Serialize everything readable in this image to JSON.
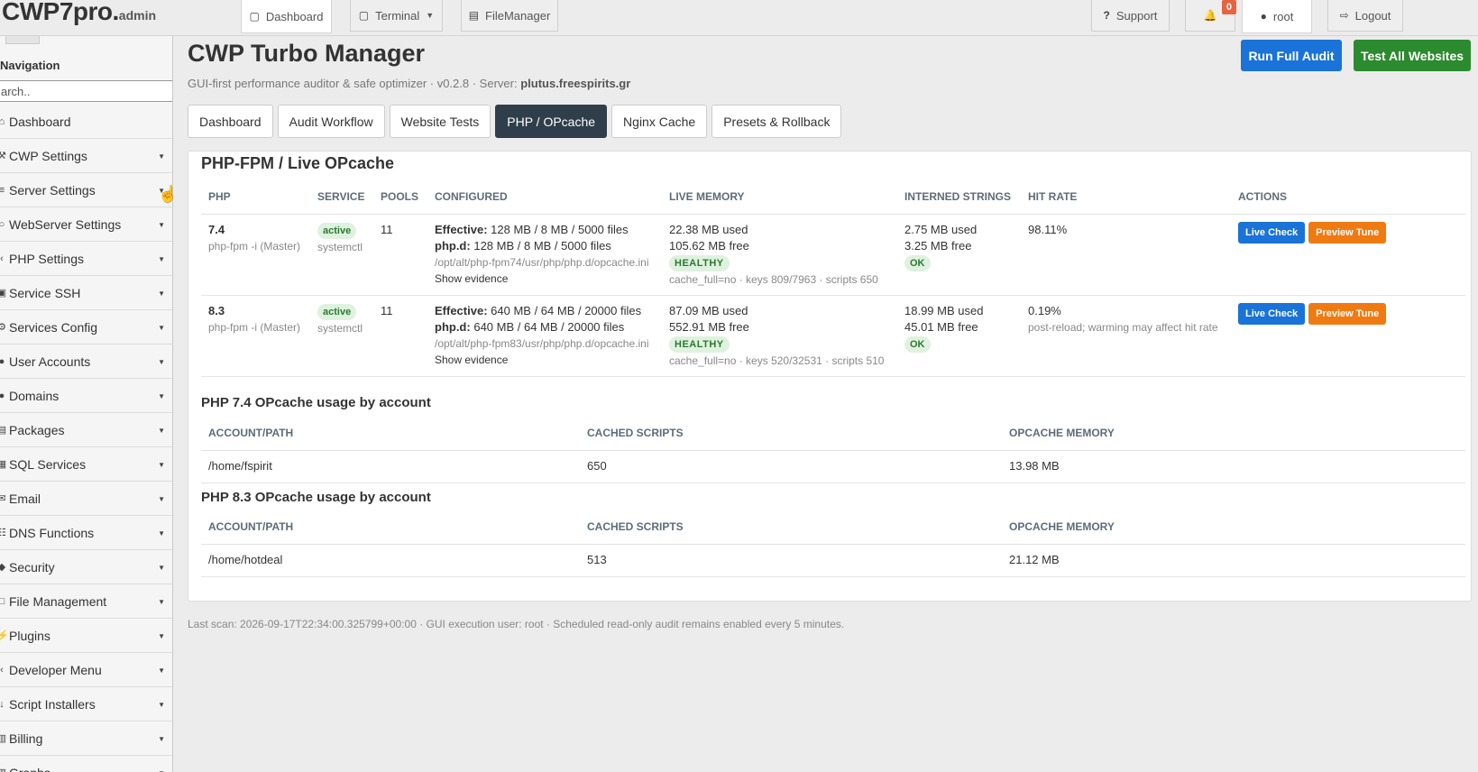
{
  "topbar": {
    "brand": "CWP7pro.",
    "brand_sub": "admin",
    "tabs": [
      {
        "label": "Dashboard",
        "icon": "monitor-icon"
      },
      {
        "label": "Terminal",
        "icon": "monitor-icon"
      },
      {
        "label": "FileManager",
        "icon": "folder-icon"
      }
    ],
    "support_label": "Support",
    "notifications_count": "0",
    "user_label": "root",
    "logout_label": "Logout"
  },
  "sidebar": {
    "title": "Navigation",
    "search_placeholder": "Search..",
    "search_value": "arch..",
    "items": [
      {
        "label": "Dashboard",
        "icon": "home-icon",
        "submenu": false
      },
      {
        "label": "CWP Settings",
        "icon": "wrench-icon",
        "submenu": true
      },
      {
        "label": "Server Settings",
        "icon": "server-icon",
        "submenu": true
      },
      {
        "label": "WebServer Settings",
        "icon": "globe-icon",
        "submenu": true
      },
      {
        "label": "PHP Settings",
        "icon": "code-icon",
        "submenu": true
      },
      {
        "label": "Service SSH",
        "icon": "terminal-icon",
        "submenu": true
      },
      {
        "label": "Services Config",
        "icon": "cog-icon",
        "submenu": true
      },
      {
        "label": "User Accounts",
        "icon": "user-icon",
        "submenu": true
      },
      {
        "label": "Domains",
        "icon": "user-icon",
        "submenu": true
      },
      {
        "label": "Packages",
        "icon": "package-icon",
        "submenu": true
      },
      {
        "label": "SQL Services",
        "icon": "database-icon",
        "submenu": true
      },
      {
        "label": "Email",
        "icon": "mail-icon",
        "submenu": true
      },
      {
        "label": "DNS Functions",
        "icon": "dns-icon",
        "submenu": true
      },
      {
        "label": "Security",
        "icon": "shield-icon",
        "submenu": true
      },
      {
        "label": "File Management",
        "icon": "file-icon",
        "submenu": true
      },
      {
        "label": "Plugins",
        "icon": "plug-icon",
        "submenu": true
      },
      {
        "label": "Developer Menu",
        "icon": "code-icon",
        "submenu": true
      },
      {
        "label": "Script Installers",
        "icon": "download-icon",
        "submenu": true
      },
      {
        "label": "Billing",
        "icon": "billing-icon",
        "submenu": true
      },
      {
        "label": "Graphs",
        "icon": "chart-icon",
        "submenu": true
      }
    ]
  },
  "header": {
    "title": "CWP Turbo Manager",
    "subtitle_prefix": "GUI-first performance auditor & safe optimizer · v0.2.8 · Server:",
    "server": "plutus.freespirits.gr",
    "run_audit_label": "Run Full Audit",
    "test_all_label": "Test All Websites"
  },
  "tabs": [
    {
      "label": "Dashboard",
      "active": false
    },
    {
      "label": "Audit Workflow",
      "active": false
    },
    {
      "label": "Website Tests",
      "active": false
    },
    {
      "label": "PHP / OPcache",
      "active": true
    },
    {
      "label": "Nginx Cache",
      "active": false
    },
    {
      "label": "Presets & Rollback",
      "active": false
    }
  ],
  "panel": {
    "title": "PHP-FPM / Live OPcache",
    "columns": [
      "PHP",
      "SERVICE",
      "POOLS",
      "CONFIGURED",
      "LIVE MEMORY",
      "INTERNED STRINGS",
      "HIT RATE",
      "ACTIONS"
    ],
    "rows": [
      {
        "version": "7.4",
        "version_sub": "php-fpm -i (Master)",
        "service_status": "active",
        "service_sub": "systemctl",
        "pools": "11",
        "effective_label": "Effective:",
        "effective_value": "128 MB / 8 MB / 5000 files",
        "phpd_label": "php.d:",
        "phpd_value": "128 MB / 8 MB / 5000 files",
        "ini_path": "/opt/alt/php-fpm74/usr/php/php.d/opcache.ini",
        "evidence_label": "Show evidence",
        "mem_used": "22.38 MB used",
        "mem_free": "105.62 MB free",
        "mem_status": "HEALTHY",
        "mem_meta": "cache_full=no · keys 809/7963 · scripts 650",
        "strings_used": "2.75 MB used",
        "strings_free": "3.25 MB free",
        "strings_status": "OK",
        "hit_rate": "98.11%",
        "hit_note": "",
        "live_check_label": "Live Check",
        "preview_tune_label": "Preview Tune"
      },
      {
        "version": "8.3",
        "version_sub": "php-fpm -i (Master)",
        "service_status": "active",
        "service_sub": "systemctl",
        "pools": "11",
        "effective_label": "Effective:",
        "effective_value": "640 MB / 64 MB / 20000 files",
        "phpd_label": "php.d:",
        "phpd_value": "640 MB / 64 MB / 20000 files",
        "ini_path": "/opt/alt/php-fpm83/usr/php/php.d/opcache.ini",
        "evidence_label": "Show evidence",
        "mem_used": "87.09 MB used",
        "mem_free": "552.91 MB free",
        "mem_status": "HEALTHY",
        "mem_meta": "cache_full=no · keys 520/32531 · scripts 510",
        "strings_used": "18.99 MB used",
        "strings_free": "45.01 MB free",
        "strings_status": "OK",
        "hit_rate": "0.19%",
        "hit_note": "post-reload; warming may affect hit rate",
        "live_check_label": "Live Check",
        "preview_tune_label": "Preview Tune"
      }
    ]
  },
  "usage74": {
    "title": "PHP 7.4 OPcache usage by account",
    "columns": [
      "ACCOUNT/PATH",
      "CACHED SCRIPTS",
      "OPCACHE MEMORY"
    ],
    "rows": [
      {
        "path": "/home/fspirit",
        "scripts": "650",
        "memory": "13.98 MB"
      }
    ]
  },
  "usage83": {
    "title": "PHP 8.3 OPcache usage by account",
    "columns": [
      "ACCOUNT/PATH",
      "CACHED SCRIPTS",
      "OPCACHE MEMORY"
    ],
    "rows": [
      {
        "path": "/home/hotdeal",
        "scripts": "513",
        "memory": "21.12 MB"
      }
    ]
  },
  "footer": "Last scan: 2026-09-17T22:34:00.325799+00:00 · GUI execution user: root · Scheduled read-only audit remains enabled every 5 minutes.",
  "colors": {
    "primary_blue": "#1a73d8",
    "success_green": "#2c8a2f",
    "warning_orange": "#f07a12",
    "active_tab": "#2f3e4a",
    "badge_red": "#e8633f"
  }
}
